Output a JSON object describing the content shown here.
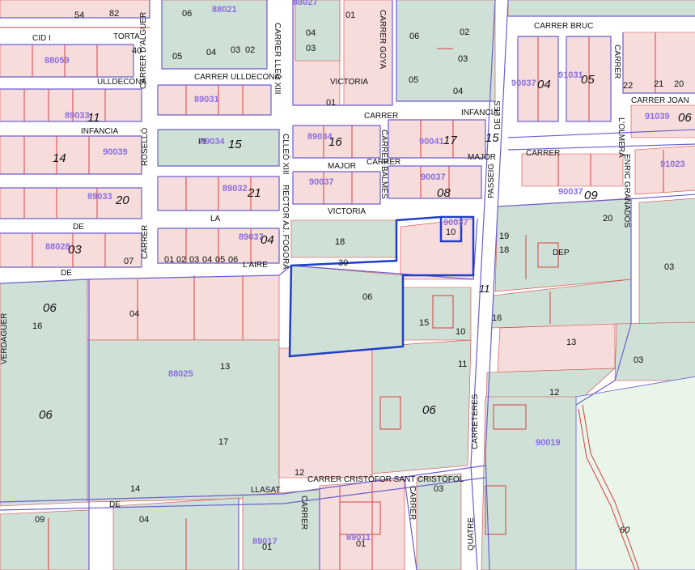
{
  "colors": {
    "street": "#ffffff",
    "street_edge": "#9b8fe0",
    "block_pink": "#f7dcdc",
    "block_green": "#cfe0d6",
    "parcel_line": "#d94040",
    "block_line": "#6b5fd0",
    "highlight": "#1f3fc8",
    "sector_text": "#8a6fe0",
    "text": "#111111",
    "field_green": "#e8f5e8"
  },
  "streets": {
    "cid": "CID I",
    "torta": "TORTA",
    "ulldecona_top": "CARRER ULLDECONA",
    "ulldecona_left": "ULLDECONA",
    "carrer_leo": "CARRER LLEÓ XIII",
    "carrer_goya": "CARRER GOYA",
    "victoria_top": "VICTORIA",
    "infancia_carrer": "CARRER",
    "infancia": "INFANCIA",
    "infancia_left": "INFANCIA",
    "carrer_alguer": "CARRER D'ALGUER",
    "major_left": "MAJOR",
    "major_carrer": "CARRER",
    "major_right": "MAJOR",
    "carrer_balmes": "CARRER BALMES",
    "rosello": "ROSELLÓ",
    "cleo": "CLLEÓ XIII",
    "rector": "RECTOR AJ. FOGORA",
    "la": "LA",
    "victoria": "VICTORIA",
    "carrer_la": "CARRER",
    "de": "DE",
    "laire": "L'AIRE",
    "de2": "DE",
    "verdaguer": "VERDAGUER",
    "passeig": "PASSEIG",
    "de_les": "DE LES",
    "carreteres": "CARRETERES",
    "quatre": "QUATRE",
    "carrer_bruc": "CARRER BRUC",
    "carrer_canova": "CARRER",
    "carrer_joan": "CARRER JOAN",
    "lolmera": "L'OLMERA",
    "enric_granados": "ENRIC GRANADOS",
    "carrer_santcristofol": "CARRER CRISTÒFOR SANT CRISTÒFOL",
    "de_llasat": "DE",
    "llasat": "LLASAT",
    "carrer_bottom1": "CARRER",
    "carrer_bottom2": "CARRER",
    "carretera": "CARRER",
    "dep": "DEP",
    "pi": "PI"
  },
  "sectors": {
    "s1": "88021",
    "s2": "88027",
    "s3": "88059",
    "s4": "89033",
    "s5": "89031",
    "s6": "90037",
    "s7": "91031",
    "s8": "90039",
    "s9": "89034",
    "s10": "91039",
    "s11": "90041",
    "s12": "91023",
    "s13": "89033",
    "s14": "90037",
    "s15": "89034",
    "s16": "90037",
    "s17": "88028",
    "s18": "89037",
    "s19": "90037",
    "s20": "88025",
    "s21": "90019",
    "s22": "89017",
    "s23": "89011",
    "s24": "89032",
    "s25": "90037"
  },
  "blocks": {
    "b54": "54",
    "b82": "82",
    "b06a": "06",
    "b01a": "01",
    "b04a": "04",
    "b03a": "03",
    "b05a": "05",
    "b04b": "04",
    "b03b": "03",
    "b02a": "02",
    "b06b": "06",
    "b02b": "02",
    "b03c": "03",
    "b05b": "05",
    "b04c": "04",
    "b40": "40",
    "b01b": "01",
    "b11a": "11",
    "b15a": "15",
    "b16a": "16",
    "b17a": "17",
    "b14a": "14",
    "b21": "21",
    "b20": "20",
    "b08a": "08",
    "b09a": "09",
    "b03d": "03",
    "b04d": "04",
    "b18": "18",
    "b30": "30",
    "b10": "10",
    "b19": "19",
    "b06c": "06",
    "b04e": "04",
    "b16b": "16",
    "b15b": "15",
    "b06d": "06",
    "b13a": "13",
    "b17b": "17",
    "b12": "12",
    "b14b": "14",
    "b06e": "06",
    "b06f": "06",
    "b11b": "11",
    "b13b": "13",
    "b03e": "03",
    "b03f": "03",
    "b20b": "20",
    "b18b": "18",
    "b16c": "16",
    "b12b": "12",
    "b01c": "01",
    "b04f": "04",
    "b01d": "01",
    "b09b": "09",
    "b03g": "03",
    "b60": "60",
    "b05c": "05",
    "b07a": "07",
    "b11c": "11",
    "b17c": "17",
    "b09c": "09",
    "b15c": "15",
    "b08b": "08",
    "b04g": "04",
    "b06g": "06",
    "b09d": "09",
    "b22": "22",
    "b21b": "21",
    "b20c": "20",
    "b05d": "05",
    "b01e": "01",
    "b02c": "02",
    "b03h": "03",
    "b04h": "04",
    "b05e": "05",
    "b06h": "06",
    "b07b": "07"
  }
}
